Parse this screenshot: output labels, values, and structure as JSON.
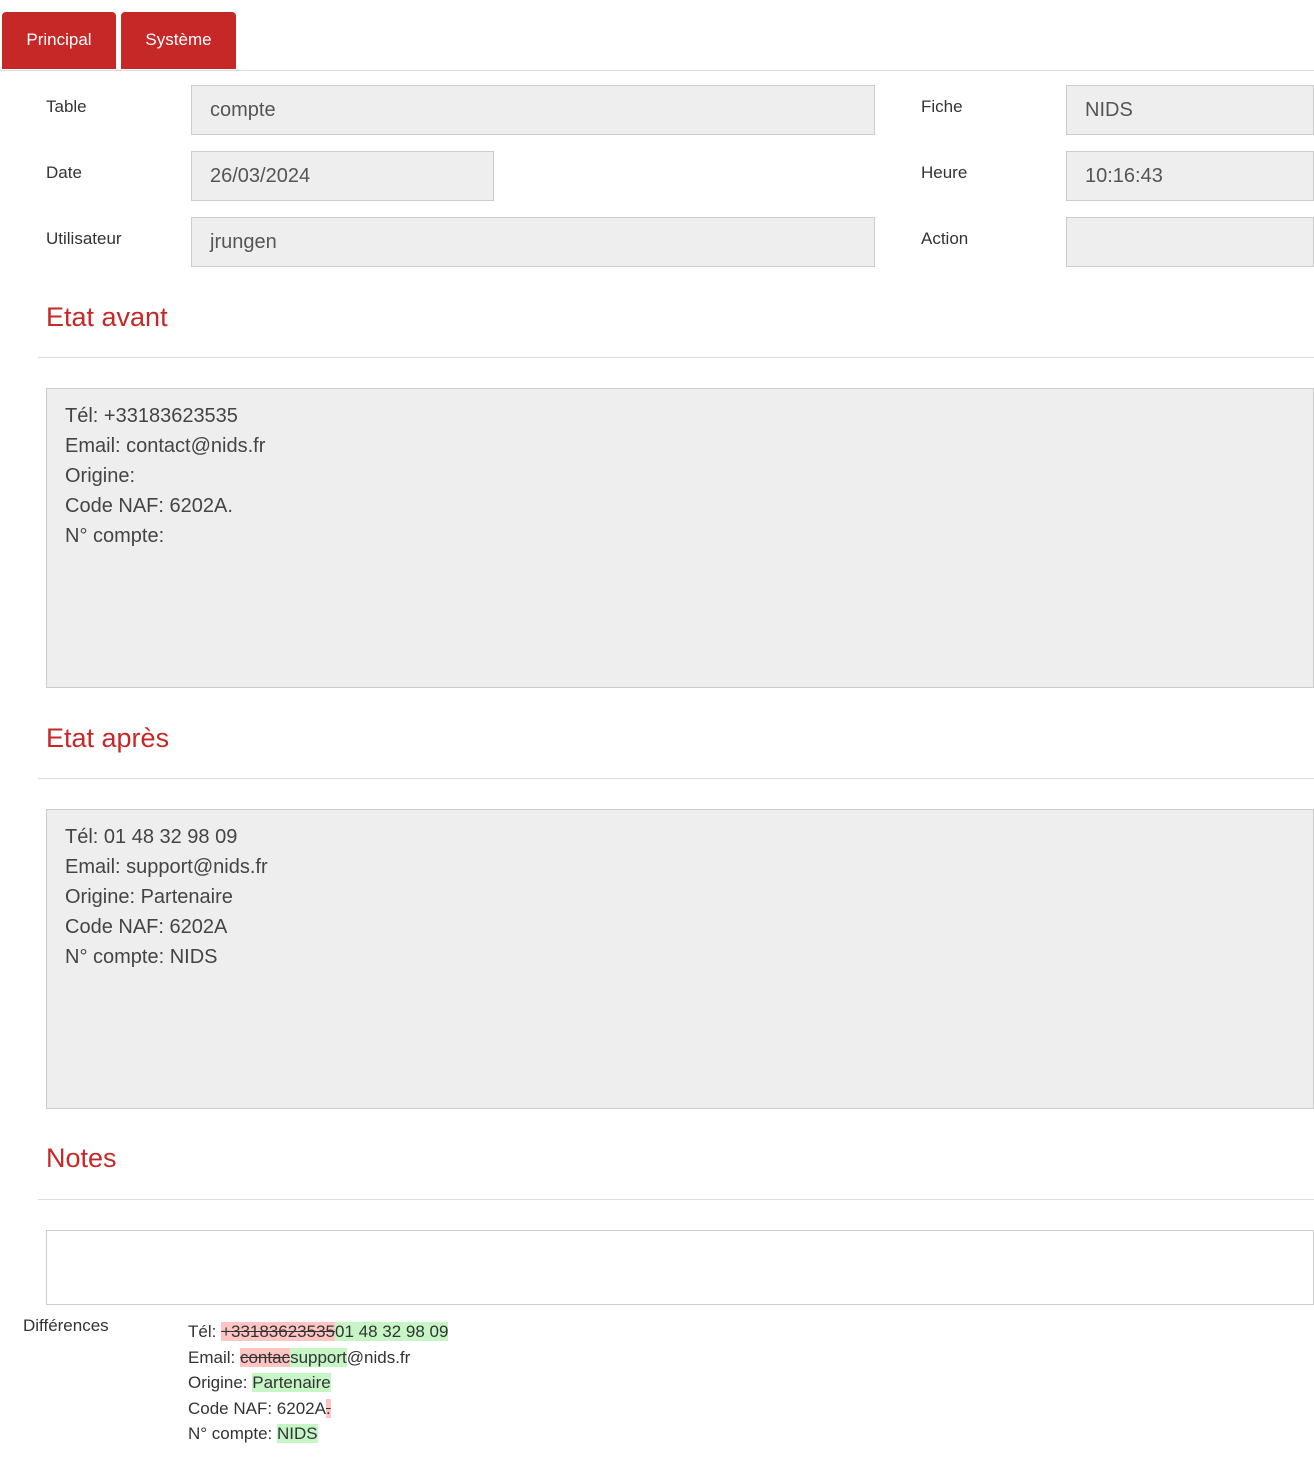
{
  "tabs": [
    "Principal",
    "Système"
  ],
  "fields": {
    "table": {
      "label": "Table",
      "value": "compte"
    },
    "fiche": {
      "label": "Fiche",
      "value": "NIDS"
    },
    "date": {
      "label": "Date",
      "value": "26/03/2024"
    },
    "heure": {
      "label": "Heure",
      "value": "10:16:43"
    },
    "utilisateur": {
      "label": "Utilisateur",
      "value": "jrungen"
    },
    "action": {
      "label": "Action",
      "value": ""
    }
  },
  "before": {
    "title": "Etat avant",
    "lines": [
      "Tél: +33183623535",
      "Email: contact@nids.fr",
      "Origine:",
      "Code NAF: 6202A.",
      "N° compte:"
    ]
  },
  "after": {
    "title": "Etat après",
    "lines": [
      "Tél: 01 48 32 98 09",
      "Email: support@nids.fr",
      "Origine: Partenaire",
      "Code NAF: 6202A",
      "N° compte: NIDS"
    ]
  },
  "notes": {
    "title": "Notes",
    "value": ""
  },
  "differences": {
    "label": "Différences",
    "lines": [
      {
        "prefix": "Tél: ",
        "removed": "+33183623535",
        "added": "01 48 32 98 09",
        "rest": ""
      },
      {
        "prefix": "Email: ",
        "removed": "contac",
        "added": "support",
        "rest": "@nids.fr"
      },
      {
        "prefix": "Origine: ",
        "removed": "",
        "added": "Partenaire",
        "rest": ""
      },
      {
        "prefix": "Code NAF: 6202A",
        "removed": ".",
        "added": "",
        "rest": ""
      },
      {
        "prefix": "N° compte: ",
        "removed": "",
        "added": "NIDS",
        "rest": ""
      }
    ]
  },
  "colors": {
    "accent": "#c62828",
    "field_bg": "#eeeeee",
    "removed_bg": "#ffc4c4",
    "added_bg": "#c6f5c6"
  }
}
